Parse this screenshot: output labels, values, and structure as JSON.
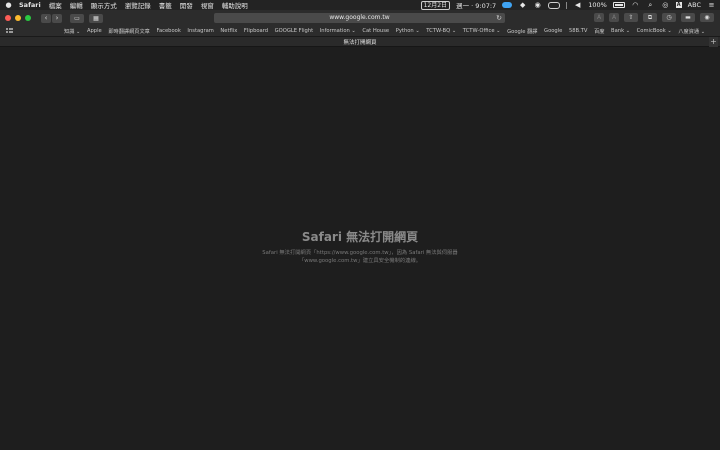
{
  "menubar": {
    "apple": "",
    "items": [
      "Safari",
      "檔案",
      "編輯",
      "顯示方式",
      "瀏覽記錄",
      "書籤",
      "開發",
      "視窗",
      "輔助說明"
    ],
    "date": "12月2日",
    "time": "週一 · 9:07:7",
    "battery": "100%",
    "input_source": "ABC"
  },
  "toolbar": {
    "back_icon": "‹",
    "forward_icon": "›",
    "address": "www.google.com.tw",
    "reload_icon": "↻"
  },
  "bookmarks": [
    "知識 ⌄",
    "Apple",
    "即時翻譯網頁文章",
    "Facebook",
    "Instagram",
    "Netflix",
    "Flipboard",
    "GOOGLE Flight",
    "Information ⌄",
    "Cat House",
    "Python ⌄",
    "TCTW-BQ ⌄",
    "TCTW-Office ⌄",
    "Google 翻譯",
    "Google",
    "58B.TV",
    "百度",
    "Bank ⌄",
    "ComicBook ⌄",
    "八度資通 ⌄"
  ],
  "tab": {
    "title": "無法打開網頁",
    "new_tab": "+"
  },
  "error": {
    "title": "Safari 無法打開網頁",
    "line1": "Safari 無法打開網頁「https://www.google.com.tw」，因為 Safari 無法與伺服器",
    "line2": "「www.google.com.tw」建立具安全機制的連線。"
  }
}
